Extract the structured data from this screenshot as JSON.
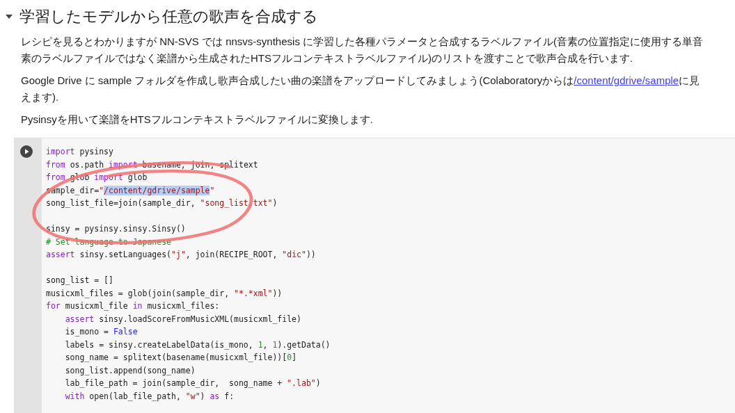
{
  "section": {
    "expanded": true,
    "title": "学習したモデルから任意の歌声を合成する"
  },
  "paragraphs": [
    {
      "segments": [
        {
          "kind": "text",
          "text": "レシピを見るとわかりますが NN-SVS では nnsvs-synthesis に学習した各種パラメータと合成するラベルファイル(音素の位置指定に使用する単音素のラベルファイルではなく楽譜から生成されたHTSフルコンテキストラベルファイル)のリストを渡すことで歌声合成を行います."
        }
      ]
    },
    {
      "segments": [
        {
          "kind": "text",
          "text": "Google Drive に sample フォルダを作成し歌声合成したい曲の楽譜をアップロードしてみましょう(Colaboratoryからは"
        },
        {
          "kind": "link",
          "text": "/content/gdrive/sample"
        },
        {
          "kind": "text",
          "text": "に見えます)."
        }
      ]
    },
    {
      "segments": [
        {
          "kind": "text",
          "text": "Pysinsyを用いて楽譜をHTSフルコンテキストラベルファイルに変換します."
        }
      ]
    }
  ],
  "code_cell": {
    "lines": [
      {
        "kind": "code",
        "indented": false,
        "tokens": [
          {
            "kind": "keyword",
            "text": "import"
          },
          {
            "kind": "plain",
            "text": " pysinsy"
          }
        ]
      },
      {
        "kind": "code",
        "indented": false,
        "tokens": [
          {
            "kind": "keyword",
            "text": "from"
          },
          {
            "kind": "plain",
            "text": " os.path "
          },
          {
            "kind": "keyword",
            "text": "import"
          },
          {
            "kind": "plain",
            "text": " basename, join, splitext"
          }
        ]
      },
      {
        "kind": "code",
        "indented": false,
        "tokens": [
          {
            "kind": "keyword",
            "text": "from"
          },
          {
            "kind": "plain",
            "text": " glob "
          },
          {
            "kind": "keyword",
            "text": "import"
          },
          {
            "kind": "plain",
            "text": " glob"
          }
        ]
      },
      {
        "kind": "code",
        "indented": false,
        "tokens": [
          {
            "kind": "plain",
            "text": "sample_dir="
          },
          {
            "kind": "string",
            "text": "\""
          },
          {
            "kind": "selection",
            "text": "/content/gdrive/sample"
          },
          {
            "kind": "string",
            "text": "\""
          }
        ]
      },
      {
        "kind": "code",
        "indented": false,
        "tokens": [
          {
            "kind": "plain",
            "text": "song_list_file=join(sample_dir, "
          },
          {
            "kind": "string",
            "text": "\"song_list.txt\""
          },
          {
            "kind": "plain",
            "text": ")"
          }
        ]
      },
      {
        "kind": "blank"
      },
      {
        "kind": "code",
        "indented": false,
        "tokens": [
          {
            "kind": "plain",
            "text": "sinsy = pysinsy.sinsy.Sinsy()"
          }
        ]
      },
      {
        "kind": "code",
        "indented": false,
        "tokens": [
          {
            "kind": "comment",
            "text": "# Set language to Japanese"
          }
        ]
      },
      {
        "kind": "code",
        "indented": false,
        "tokens": [
          {
            "kind": "keyword",
            "text": "assert"
          },
          {
            "kind": "plain",
            "text": " sinsy.setLanguages("
          },
          {
            "kind": "string",
            "text": "\"j\""
          },
          {
            "kind": "plain",
            "text": ", join(RECIPE_ROOT, "
          },
          {
            "kind": "string",
            "text": "\"dic\""
          },
          {
            "kind": "plain",
            "text": "))"
          }
        ]
      },
      {
        "kind": "blank"
      },
      {
        "kind": "code",
        "indented": false,
        "tokens": [
          {
            "kind": "plain",
            "text": "song_list = []"
          }
        ]
      },
      {
        "kind": "code",
        "indented": false,
        "tokens": [
          {
            "kind": "plain",
            "text": "musicxml_files = glob(join(sample_dir, "
          },
          {
            "kind": "string",
            "text": "\"*.*xml\""
          },
          {
            "kind": "plain",
            "text": "))"
          }
        ]
      },
      {
        "kind": "code",
        "indented": false,
        "tokens": [
          {
            "kind": "keyword",
            "text": "for"
          },
          {
            "kind": "plain",
            "text": " musicxml_file "
          },
          {
            "kind": "keyword",
            "text": "in"
          },
          {
            "kind": "plain",
            "text": " musicxml_files:"
          }
        ]
      },
      {
        "kind": "code",
        "indented": true,
        "tokens": [
          {
            "kind": "keyword",
            "text": "assert"
          },
          {
            "kind": "plain",
            "text": " sinsy.loadScoreFromMusicXML(musicxml_file)"
          }
        ]
      },
      {
        "kind": "code",
        "indented": true,
        "tokens": [
          {
            "kind": "plain",
            "text": "is_mono = "
          },
          {
            "kind": "constant",
            "text": "False"
          }
        ]
      },
      {
        "kind": "code",
        "indented": true,
        "tokens": [
          {
            "kind": "plain",
            "text": "labels = sinsy.createLabelData(is_mono, "
          },
          {
            "kind": "number",
            "text": "1"
          },
          {
            "kind": "plain",
            "text": ", "
          },
          {
            "kind": "number",
            "text": "1"
          },
          {
            "kind": "plain",
            "text": ").getData()"
          }
        ]
      },
      {
        "kind": "code",
        "indented": true,
        "tokens": [
          {
            "kind": "plain",
            "text": "song_name = splitext(basename(musicxml_file))["
          },
          {
            "kind": "number",
            "text": "0"
          },
          {
            "kind": "plain",
            "text": "]"
          }
        ]
      },
      {
        "kind": "code",
        "indented": true,
        "tokens": [
          {
            "kind": "plain",
            "text": "song_list.append(song_name)"
          }
        ]
      },
      {
        "kind": "code",
        "indented": true,
        "tokens": [
          {
            "kind": "plain",
            "text": "lab_file_path = join(sample_dir,  song_name + "
          },
          {
            "kind": "string",
            "text": "\".lab\""
          },
          {
            "kind": "plain",
            "text": ")"
          }
        ]
      },
      {
        "kind": "code",
        "indented": true,
        "tokens": [
          {
            "kind": "keyword",
            "text": "with"
          },
          {
            "kind": "plain",
            "text": " open(lab_file_path, "
          },
          {
            "kind": "string",
            "text": "\"w\""
          },
          {
            "kind": "plain",
            "text": ") "
          },
          {
            "kind": "keyword",
            "text": "as"
          },
          {
            "kind": "plain",
            "text": " f:"
          }
        ]
      }
    ]
  }
}
